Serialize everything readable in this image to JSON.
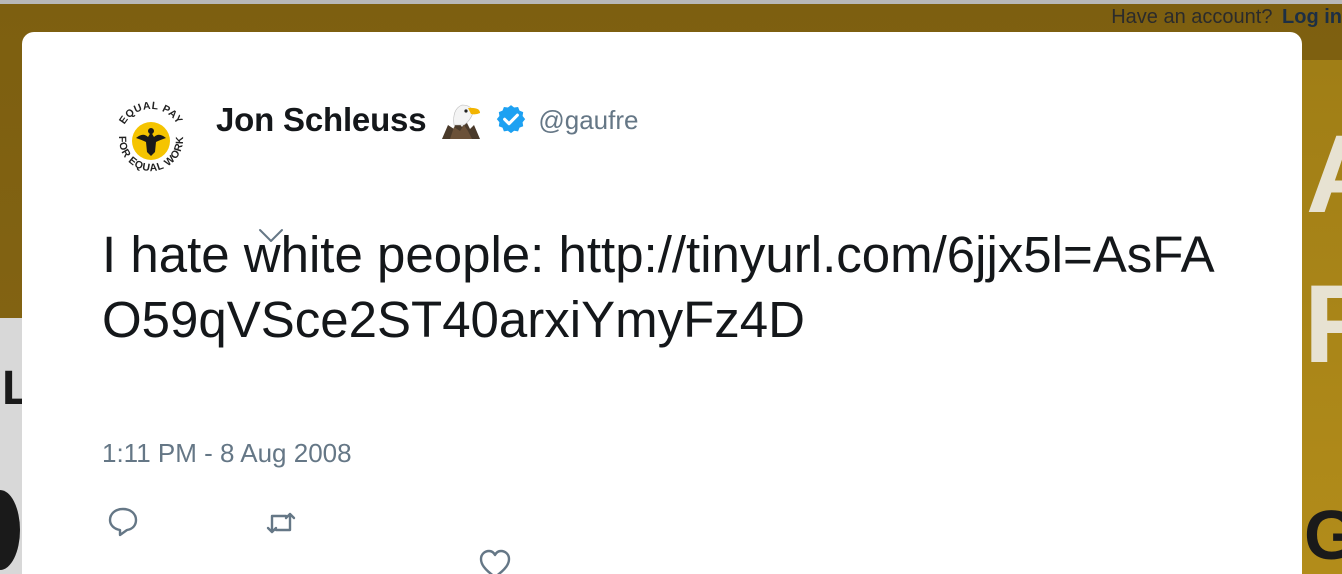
{
  "account_bar": {
    "prompt": "Have an account?",
    "login_label": "Log in"
  },
  "background": {
    "left_letter": "L",
    "right_letters": [
      "A",
      "R",
      "G"
    ]
  },
  "tweet": {
    "display_name": "Jon Schleuss",
    "name_emoji_icon": "eagle-icon",
    "verified_icon": "verified-badge-icon",
    "handle": "@gaufre",
    "avatar_icon": "equal-pay-logo-icon",
    "avatar_text": "EQUAL PAY FOR EQUAL WORK",
    "text": "I hate white people: http://tinyurl.com/6jjx5l=AsFAO59qVSce2ST40arxiYmyFz4D",
    "timestamp": "1:11 PM - 8 Aug 2008",
    "actions": {
      "reply_icon": "reply-icon",
      "retweet_icon": "retweet-icon",
      "like_icon": "heart-icon"
    }
  },
  "colors": {
    "background": "#7d5f10",
    "card": "#ffffff",
    "text": "#14171a",
    "muted": "#657786",
    "verified": "#1da1f2",
    "avatar_accent": "#f5c400"
  }
}
